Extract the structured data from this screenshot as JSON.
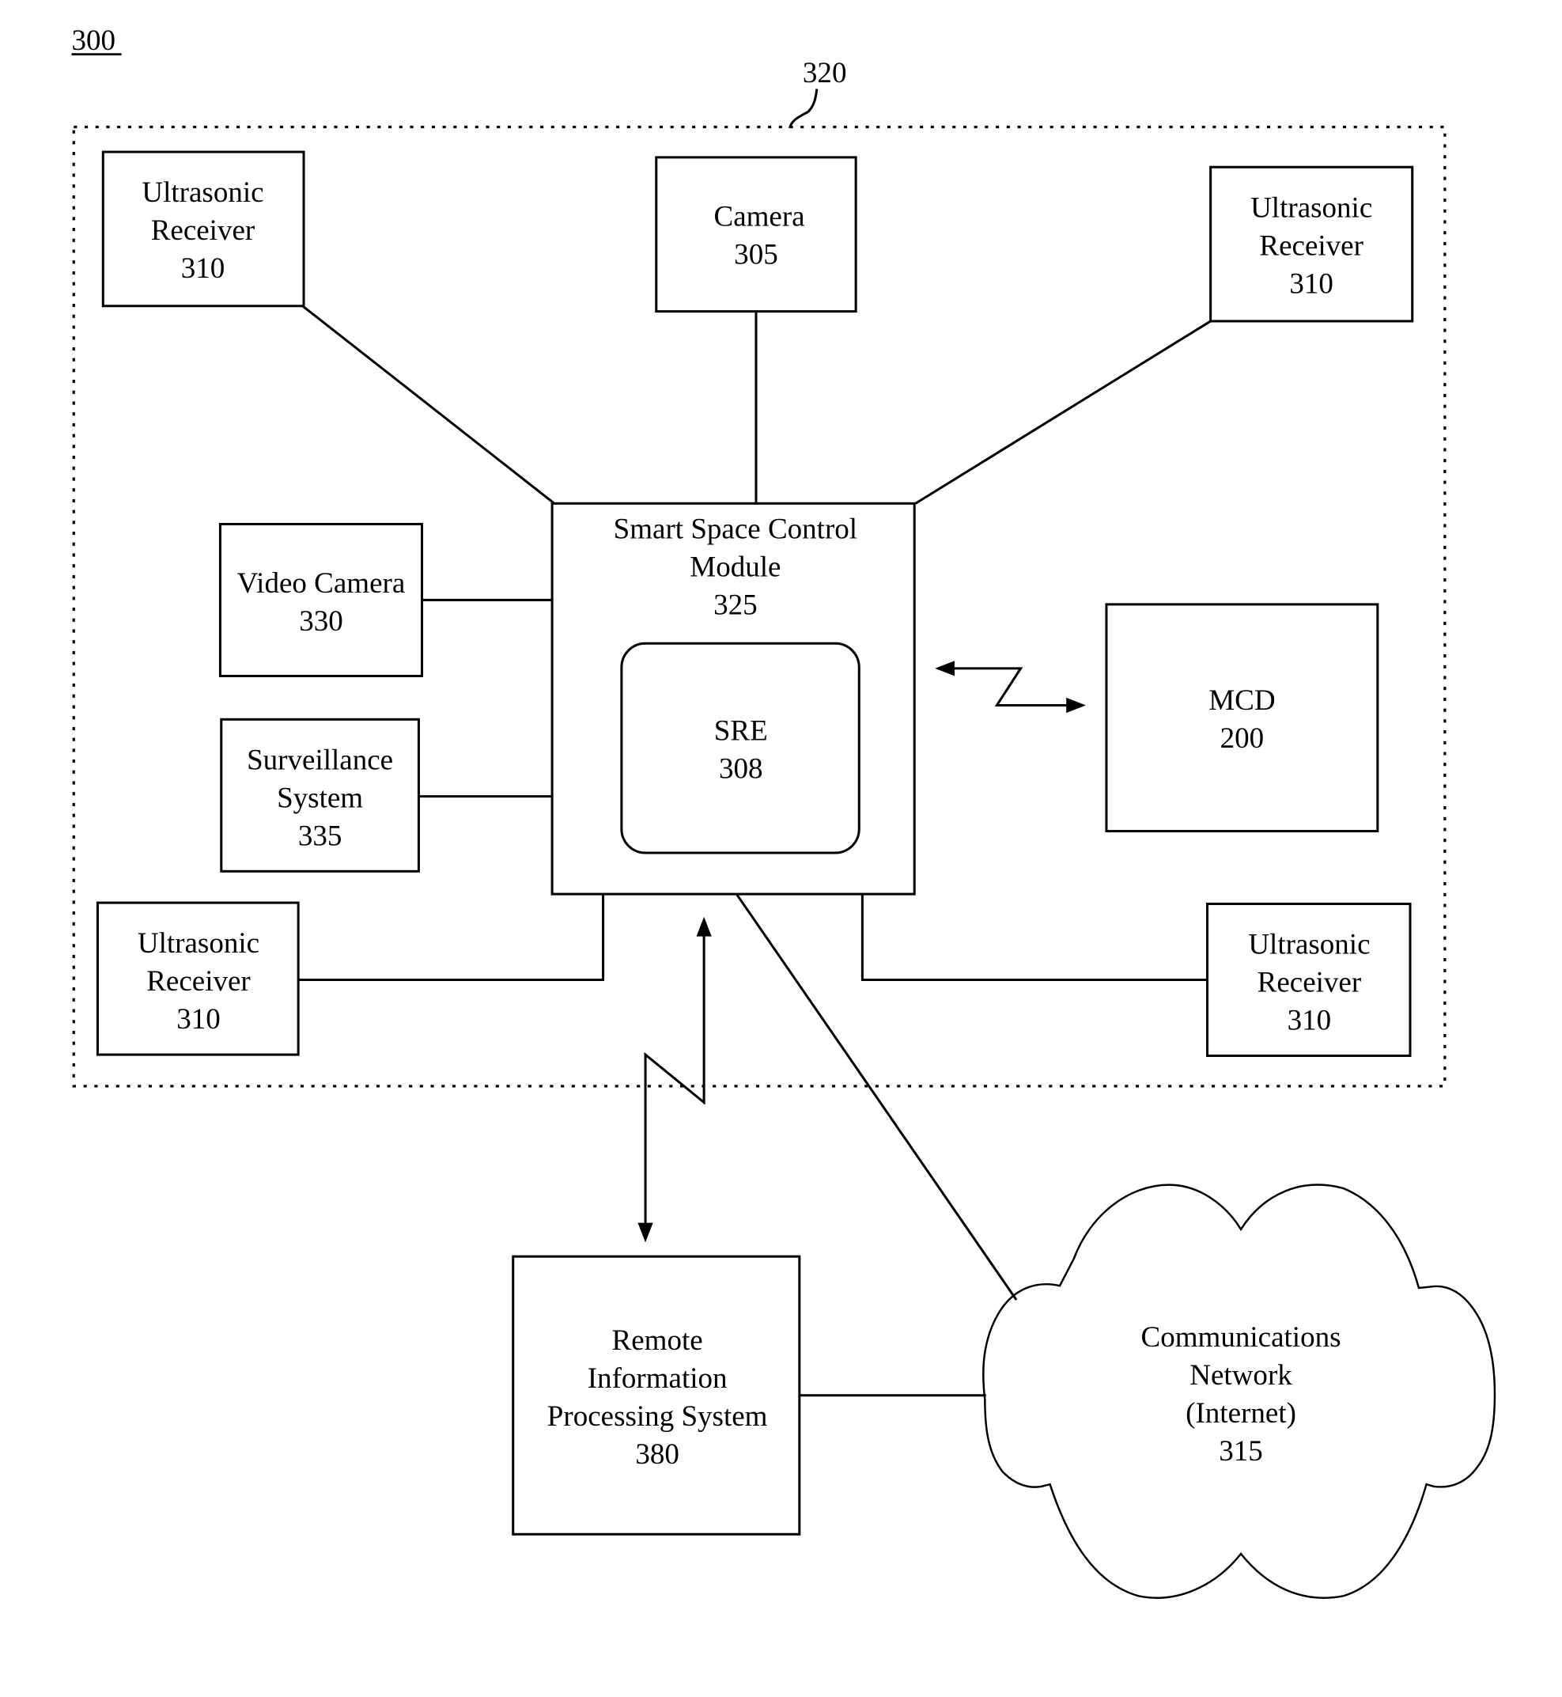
{
  "figure": {
    "figure_ref": "300",
    "boundary_ref": "320"
  },
  "nodes": {
    "ultrasonic_top_left": {
      "lines": [
        "Ultrasonic",
        "Receiver",
        "310"
      ]
    },
    "camera": {
      "lines": [
        "Camera",
        "305"
      ]
    },
    "ultrasonic_top_right": {
      "lines": [
        "Ultrasonic",
        "Receiver",
        "310"
      ]
    },
    "video_camera": {
      "lines": [
        "Video Camera",
        "330"
      ]
    },
    "surveillance": {
      "lines": [
        "Surveillance",
        "System",
        "335"
      ]
    },
    "control_module": {
      "lines": [
        "Smart Space Control",
        "Module",
        "325"
      ]
    },
    "sre": {
      "lines": [
        "SRE",
        "308"
      ]
    },
    "mcd": {
      "lines": [
        "MCD",
        "200"
      ]
    },
    "ultrasonic_bottom_left": {
      "lines": [
        "Ultrasonic",
        "Receiver",
        "310"
      ]
    },
    "ultrasonic_bottom_right": {
      "lines": [
        "Ultrasonic",
        "Receiver",
        "310"
      ]
    },
    "remote_system": {
      "lines": [
        "Remote",
        "Information",
        "Processing System",
        "380"
      ]
    },
    "network": {
      "lines": [
        "Communications",
        "Network",
        "(Internet)",
        "315"
      ]
    }
  },
  "connections": [
    {
      "from": "ultrasonic_top_left",
      "to": "control_module",
      "type": "wired"
    },
    {
      "from": "camera",
      "to": "control_module",
      "type": "wired"
    },
    {
      "from": "ultrasonic_top_right",
      "to": "control_module",
      "type": "wired"
    },
    {
      "from": "video_camera",
      "to": "control_module",
      "type": "wired"
    },
    {
      "from": "surveillance",
      "to": "control_module",
      "type": "wired"
    },
    {
      "from": "ultrasonic_bottom_left",
      "to": "control_module",
      "type": "wired"
    },
    {
      "from": "ultrasonic_bottom_right",
      "to": "control_module",
      "type": "wired"
    },
    {
      "from": "control_module",
      "to": "mcd",
      "type": "wireless-bidirectional"
    },
    {
      "from": "control_module",
      "to": "remote_system",
      "type": "wireless-bidirectional"
    },
    {
      "from": "control_module",
      "to": "network",
      "type": "wired"
    },
    {
      "from": "remote_system",
      "to": "network",
      "type": "wired"
    }
  ]
}
